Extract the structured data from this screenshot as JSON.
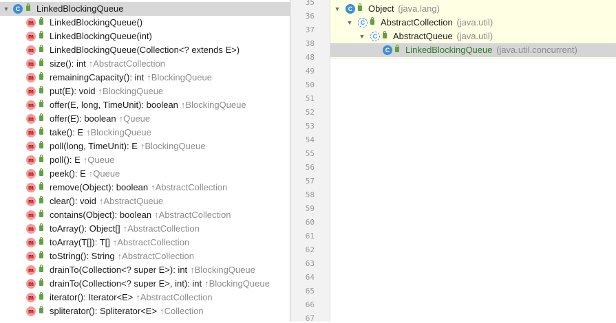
{
  "structure": {
    "root": {
      "label": "LinkedBlockingQueue",
      "icon": "class-icon",
      "toggle": "▼"
    },
    "members": [
      {
        "name": "LinkedBlockingQueue()",
        "owner": ""
      },
      {
        "name": "LinkedBlockingQueue(int)",
        "owner": ""
      },
      {
        "name": "LinkedBlockingQueue(Collection<? extends E>)",
        "owner": ""
      },
      {
        "name": "size(): int",
        "owner": "↑AbstractCollection"
      },
      {
        "name": "remainingCapacity(): int",
        "owner": "↑BlockingQueue"
      },
      {
        "name": "put(E): void",
        "owner": "↑BlockingQueue"
      },
      {
        "name": "offer(E, long, TimeUnit): boolean",
        "owner": "↑BlockingQueue"
      },
      {
        "name": "offer(E): boolean",
        "owner": "↑Queue"
      },
      {
        "name": "take(): E",
        "owner": "↑BlockingQueue"
      },
      {
        "name": "poll(long, TimeUnit): E",
        "owner": "↑BlockingQueue"
      },
      {
        "name": "poll(): E",
        "owner": "↑Queue"
      },
      {
        "name": "peek(): E",
        "owner": "↑Queue"
      },
      {
        "name": "remove(Object): boolean",
        "owner": "↑AbstractCollection"
      },
      {
        "name": "clear(): void",
        "owner": "↑AbstractQueue"
      },
      {
        "name": "contains(Object): boolean",
        "owner": "↑AbstractCollection"
      },
      {
        "name": "toArray(): Object[]",
        "owner": "↑AbstractCollection"
      },
      {
        "name": "toArray(T[]): T[]",
        "owner": "↑AbstractCollection"
      },
      {
        "name": "toString(): String",
        "owner": "↑AbstractCollection"
      },
      {
        "name": "drainTo(Collection<? super E>): int",
        "owner": "↑BlockingQueue"
      },
      {
        "name": "drainTo(Collection<? super E>, int): int",
        "owner": "↑BlockingQueue"
      },
      {
        "name": "iterator(): Iterator<E>",
        "owner": "↑AbstractCollection"
      },
      {
        "name": "spliterator(): Spliterator<E>",
        "owner": "↑Collection"
      }
    ]
  },
  "gutter": {
    "line_numbers": [
      "35",
      "36",
      "37",
      "38",
      "48",
      "49",
      "50",
      "51",
      "52",
      "53",
      "54",
      "55",
      "56",
      "57",
      "58",
      "59",
      "60",
      "61",
      "62",
      "63",
      "64",
      "65",
      "66",
      "67"
    ]
  },
  "hierarchy": {
    "nodes": [
      {
        "name": "Object",
        "package": "(java.lang)",
        "toggle": "▼",
        "icon": "class-icon",
        "abstract": false,
        "selected": false
      },
      {
        "name": "AbstractCollection",
        "package": "(java.util)",
        "toggle": "▼",
        "icon": "abstract-class-icon",
        "abstract": true,
        "selected": false
      },
      {
        "name": "AbstractQueue",
        "package": "(java.util)",
        "toggle": "▼",
        "icon": "abstract-class-icon",
        "abstract": true,
        "selected": false
      },
      {
        "name": "LinkedBlockingQueue",
        "package": "(java.util.concurrent)",
        "toggle": "",
        "icon": "class-icon",
        "abstract": false,
        "selected": true
      }
    ]
  },
  "colors": {
    "selection": "#d8d8d8",
    "hierarchy_background": "#ffffe4",
    "current_class": "#2f7d2f",
    "owner_text": "#8c8c8c",
    "method_icon": "#f19a9a",
    "class_icon": "#3d8ed9"
  }
}
